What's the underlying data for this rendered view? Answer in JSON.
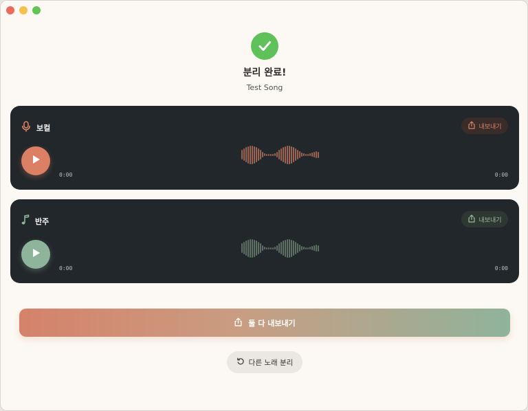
{
  "window": {
    "title": ""
  },
  "result": {
    "title": "분리 완료!",
    "song_name": "Test Song"
  },
  "tracks": [
    {
      "label": "보컬",
      "icon": "microphone-icon",
      "export_label": "내보내기",
      "current_time": "0:00",
      "duration": "0:00",
      "color": "#db7f65"
    },
    {
      "label": "반주",
      "icon": "music-note-icon",
      "export_label": "내보내기",
      "current_time": "0:00",
      "duration": "0:00",
      "color": "#8eb49c"
    }
  ],
  "actions": {
    "export_both_label": "둘 다 내보내기",
    "separate_again_label": "다른 노래 분리"
  },
  "colors": {
    "success": "#5fc15a",
    "vocal_accent": "#db7f65",
    "instrumental_accent": "#8eb49c",
    "track_bg": "#22272b"
  }
}
